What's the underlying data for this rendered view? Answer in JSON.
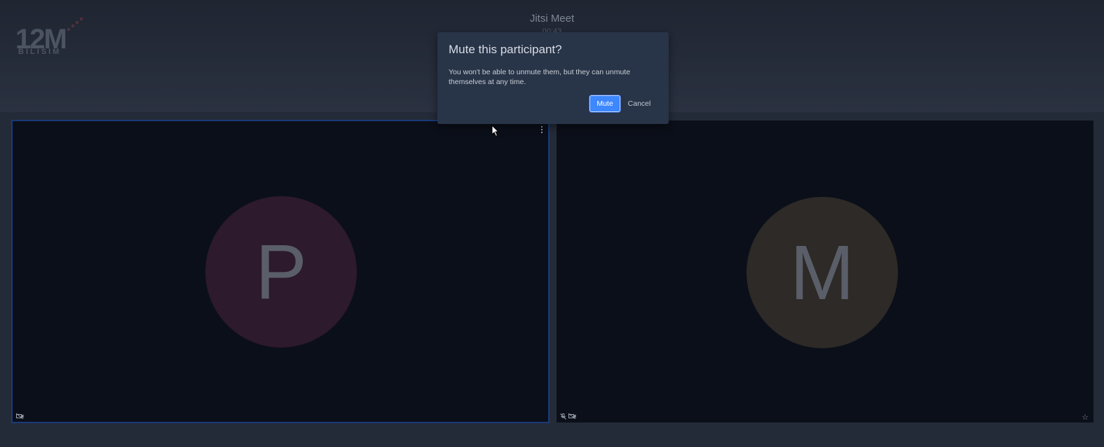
{
  "header": {
    "logo_text": "12M",
    "logo_subtext": "BILISIM",
    "title": "Jitsi Meet",
    "timer": "00:43"
  },
  "tiles": [
    {
      "initial": "P",
      "avatar_color": "#2d1a2c",
      "status_icons": [
        "video-off-icon"
      ]
    },
    {
      "initial": "M",
      "avatar_color": "#2d2a27",
      "status_icons": [
        "mic-off-icon",
        "video-off-icon"
      ]
    }
  ],
  "dialog": {
    "title": "Mute this participant?",
    "body": "You won't be able to unmute them, but they can unmute themselves at any time.",
    "mute_label": "Mute",
    "cancel_label": "Cancel"
  },
  "colors": {
    "accent": "#3d87ff",
    "background": "#242b38",
    "tile": "#0b0f19",
    "active_border": "#1a3a7a"
  }
}
